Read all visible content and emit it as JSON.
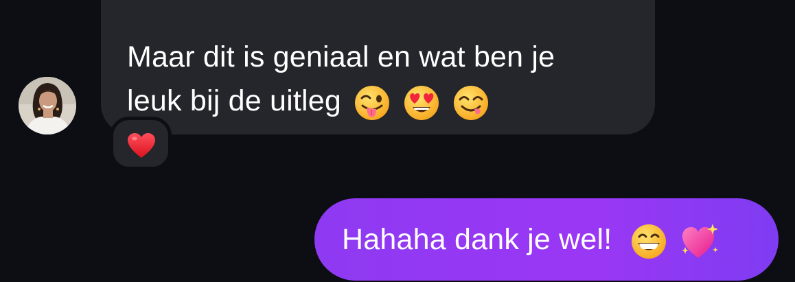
{
  "conversation": {
    "incoming_message": {
      "line1": "Maar dit is geniaal en wat ben je",
      "line2": "leuk bij de uitleg",
      "emojis": [
        "winking-face-tongue-icon",
        "heart-eyes-icon",
        "yum-face-icon"
      ],
      "reaction": "red-heart-icon"
    },
    "outgoing_message": {
      "text": "Hahaha dank je wel!",
      "emojis": [
        "grinning-face-icon",
        "sparkling-heart-icon"
      ],
      "colors": {
        "from": "#8e3af2",
        "to": "#7f3cf2"
      }
    },
    "colors": {
      "background": "#0d0e14",
      "incoming_bubble": "#25262b",
      "text": "#ffffff"
    }
  }
}
